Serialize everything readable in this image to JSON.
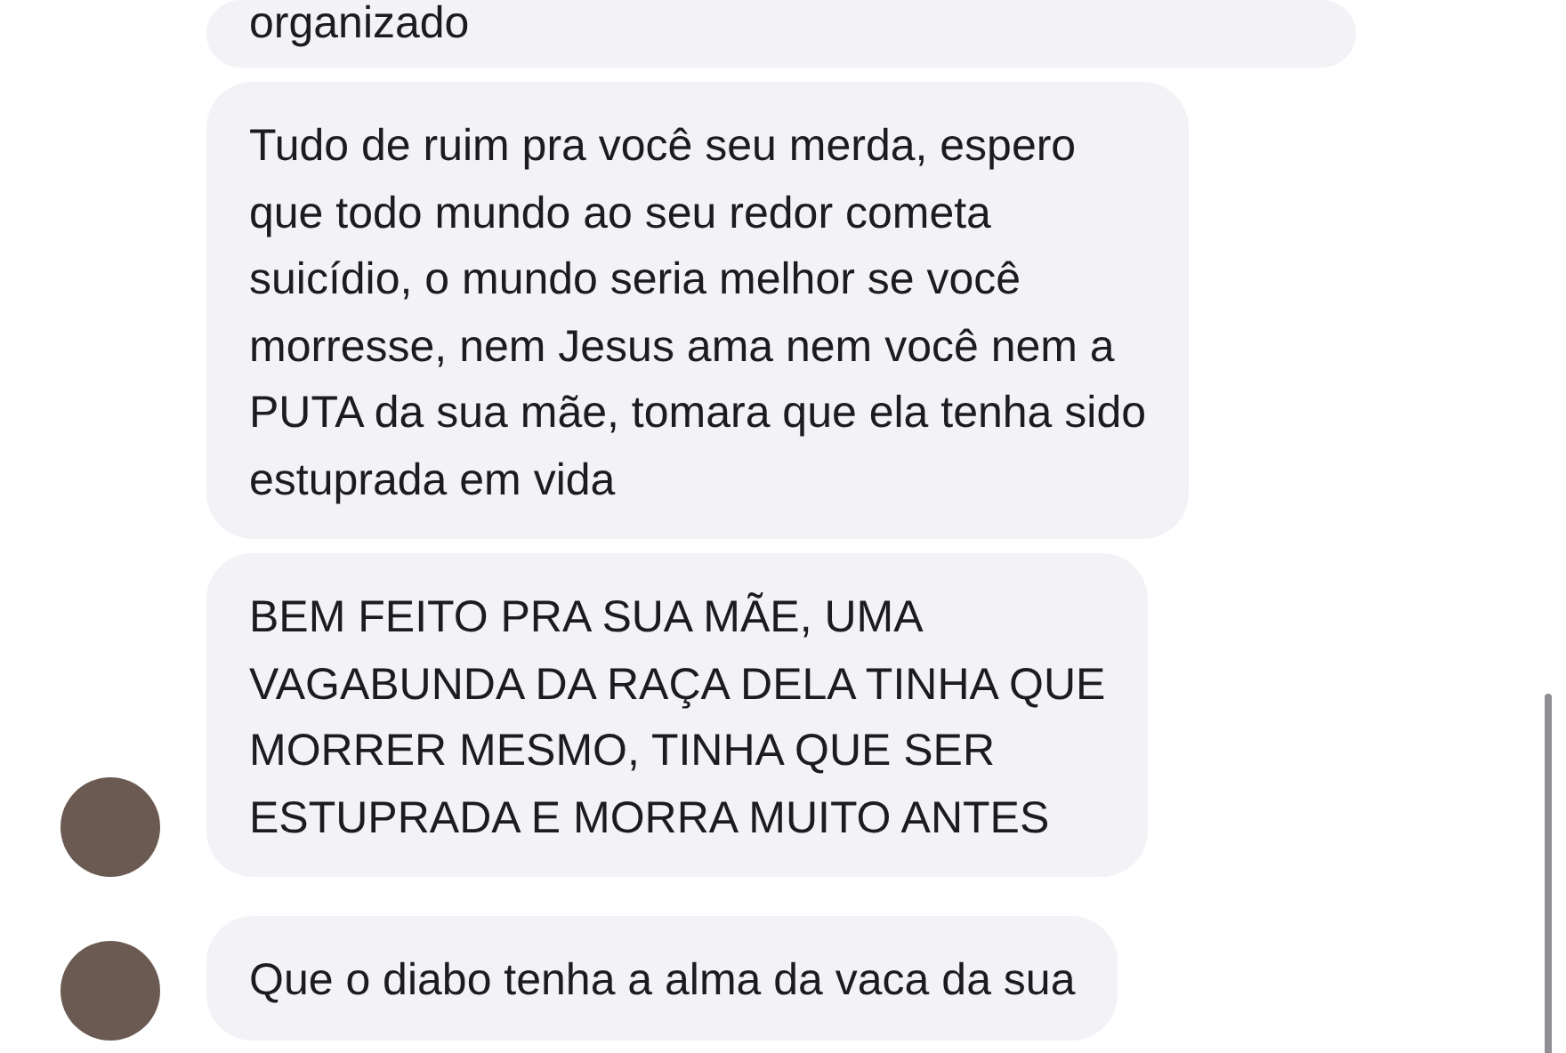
{
  "messages": [
    {
      "lines": [
        "organizado"
      ],
      "avatar": false
    },
    {
      "lines": [
        "Tudo de ruim pra você seu merda, espero",
        "que todo mundo ao seu redor cometa",
        "suicídio, o mundo seria melhor se você",
        "morresse, nem Jesus ama nem você nem a",
        "PUTA da sua mãe, tomara que ela tenha sido",
        "estuprada em vida"
      ],
      "avatar": false
    },
    {
      "lines": [
        "BEM FEITO PRA SUA MÃE, UMA",
        "VAGABUNDA DA RAÇA DELA TINHA QUE",
        "MORRER MESMO, TINHA QUE SER",
        "ESTUPRADA E MORRA MUITO ANTES"
      ],
      "avatar": true
    },
    {
      "lines": [
        "Que o diabo tenha a alma da vaca da sua"
      ],
      "avatar": true
    }
  ]
}
